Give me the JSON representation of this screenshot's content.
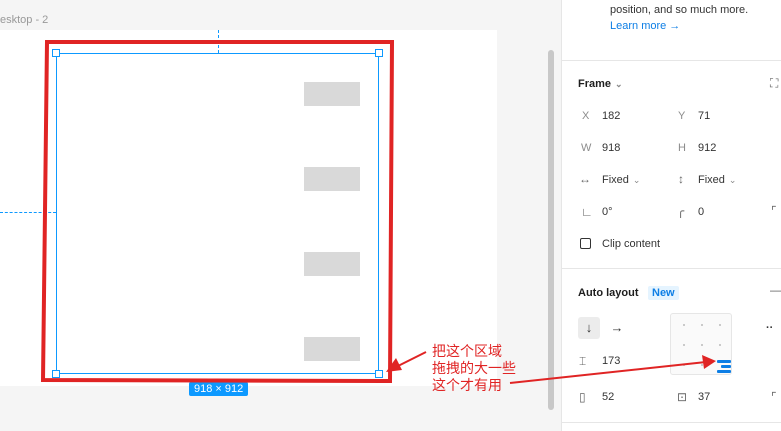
{
  "canvas": {
    "frame_label": "esktop - 2",
    "size_badge": "918 × 912"
  },
  "annotation": {
    "text": "把这个区域\n拖拽的大一些\n这个才有用",
    "color": "#e02424"
  },
  "panel": {
    "tip_text": "position, and so much more.",
    "learn_more": "Learn more →",
    "frame": {
      "title": "Frame",
      "x_label": "X",
      "x_value": "182",
      "y_label": "Y",
      "y_value": "71",
      "w_label": "W",
      "w_value": "918",
      "h_label": "H",
      "h_value": "912",
      "width_mode": "Fixed",
      "height_mode": "Fixed",
      "rotation": "0°",
      "radius": "0",
      "clip_content": "Clip content"
    },
    "auto_layout": {
      "title": "Auto layout",
      "badge": "New",
      "direction_down": "↓",
      "direction_right": "→",
      "gap": "173",
      "padding_horizontal": "52",
      "padding_vertical": "37",
      "more": "··"
    }
  },
  "colors": {
    "accent": "#0d99ff",
    "annotation_red": "#e02424"
  }
}
